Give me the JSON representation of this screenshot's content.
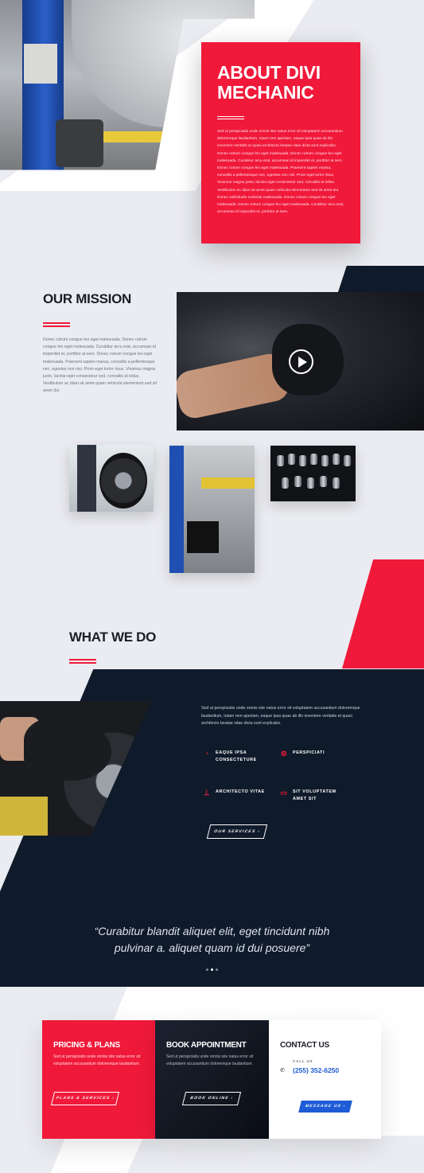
{
  "about": {
    "title_line1": "ABOUT DIVI",
    "title_line2": "MECHANIC",
    "body": "Sed ut perspiciatis unde omnis iste natus error sit voluptatem accusantium doloremque laudantium, totam rem aperiam, eaque ipsa quae ab illo inventore veritatis et quasi architecto beatae vitae dicta sunt explicabo. Donec rutrum congue leo eget malesuada. Donec rutrum congue leo eget malesuada. Curabitur arcu erat, accumsan id imperdiet et, porttitor at sem. Donec rutrum congue leo eget malesuada. Praesent sapien massa, convallis a pellentesque nec, egestas non nisi. Proin eget tortor risus. Vivamus magna justo, lacinia eget consectetur sed, convallis at tellus. Vestibulum ac diam sit amet quam vehicula elementum sed sit amet dui. Donec sollicitudin molestie malesuada. Donec rutrum congue leo eget malesuada. Donec rutrum congue leo eget malesuada. Curabitur arcu erat, accumsan id imperdiet et, porttitor at sem."
  },
  "mission": {
    "title": "OUR MISSION",
    "body": "Donec rutrum congue leo eget malesuada. Donec rutrum congue leo eget malesuada. Curabitur arcu erat, accumsan id imperdiet et, porttitor at sem. Donec rutrum congue leo eget malesuada. Praesent sapien massa, convallis a pellentesque nec, egestas non nisi. Proin eget tortor risus. Vivamus magna justo, lacinia eget consectetur sed, convallis at tellus. Vestibulum ac diam sit amet quam vehicula elementum sed sit amet dui."
  },
  "what_we_do": {
    "title": "WHAT WE DO",
    "body": "Sed ut perspiciatis unde omnis iste natus error sit voluptatem accusantium doloremque laudantium, totam rem aperiam, eaque ipsa quae ab illo inventore veritatis et quasi architecto beatae vitae dicta sunt explicabo.",
    "services": [
      {
        "icon": "gauge-icon",
        "line1": "EAQUE IPSA",
        "line2": "CONSECTETURE"
      },
      {
        "icon": "wrench-gear-icon",
        "line1": "PERSPICIATI",
        "line2": ""
      },
      {
        "icon": "car-lift-icon",
        "line1": "ARCHITECTO VITAE",
        "line2": ""
      },
      {
        "icon": "car-icon",
        "line1": "SIT VOLUPTATEM",
        "line2": "AMET SIT"
      }
    ],
    "button": "OUR SERVICES ›"
  },
  "testimonial": {
    "quote_line1": "“Curabitur blandit aliquet elit, eget tincidunt nibh",
    "quote_line2": "pulvinar a. aliquet quam id dui posuere”"
  },
  "cta": {
    "pricing": {
      "title": "PRICING & PLANS",
      "body": "Sed ut perspiciatis unde omnis iste natus error sit voluptatem accusantium doloremque laudantium.",
      "button": "PLANS & SERVICES ›"
    },
    "booking": {
      "title": "BOOK APPOINTMENT",
      "body": "Sed ut perspiciatis unde omnis iste natus error sit voluptatem accusantium doloremque laudantium.",
      "button": "BOOK ONLINE ›"
    },
    "contact": {
      "title": "CONTACT US",
      "call_label": "CALL US",
      "phone": "(255) 352-6250",
      "button": "MESSAGE US ›"
    }
  },
  "colors": {
    "accent": "#f0193a",
    "navy": "#0f1a2a",
    "blue": "#1e5bd6",
    "background": "#ebecf1"
  }
}
